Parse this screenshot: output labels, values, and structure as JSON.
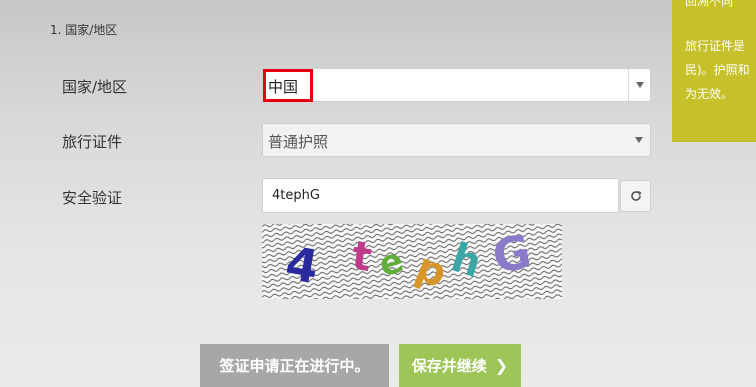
{
  "section": {
    "title": "1. 国家/地区"
  },
  "form": {
    "country": {
      "label": "国家/地区",
      "value": "中国"
    },
    "travel_doc": {
      "label": "旅行证件",
      "value": "普通护照"
    },
    "security": {
      "label": "安全验证",
      "input_value": "4tephG",
      "captcha_text": "4tephG",
      "captcha_chars": [
        "4",
        "t",
        "e",
        "p",
        "h",
        "G"
      ],
      "captcha_colors": [
        "#2a2a9e",
        "#c03a8a",
        "#5fae3a",
        "#d8962a",
        "#3aa6a6",
        "#8b79c9"
      ]
    }
  },
  "buttons": {
    "in_progress": "签证申请正在进行中。",
    "save_continue": "保存并继续"
  },
  "side_panel": {
    "line_top": "回溯不同",
    "line1": "旅行证件是",
    "line2": "民)。护照和",
    "line3": "为无效。"
  },
  "colors": {
    "accent_green": "#9dc558",
    "panel_olive": "#c6c02a",
    "highlight_red": "#e60012"
  }
}
